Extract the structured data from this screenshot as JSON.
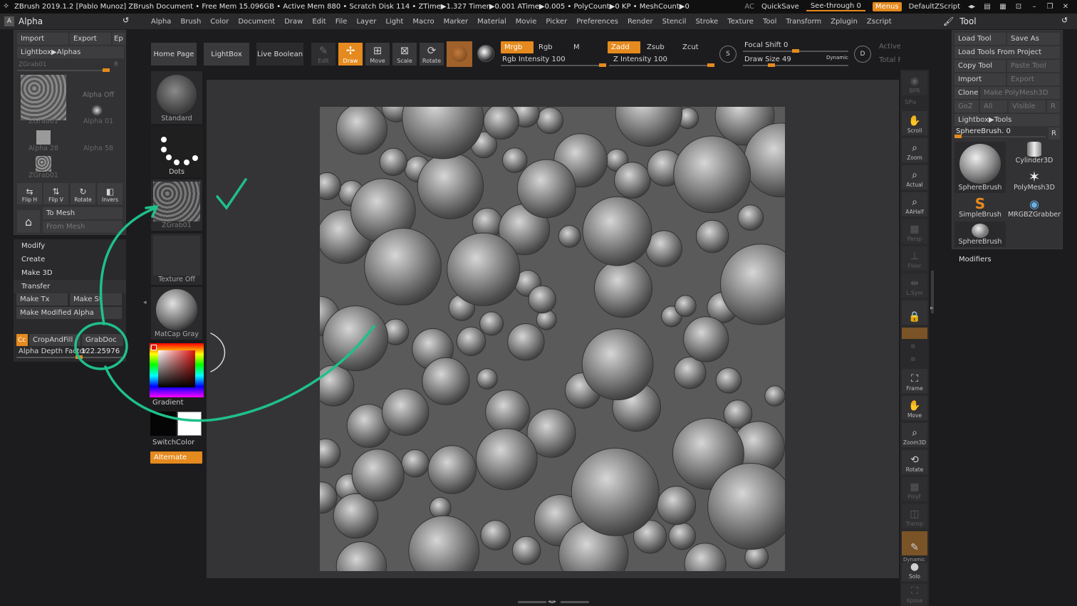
{
  "titlebar": {
    "text": "ZBrush 2019.1.2 [Pablo Munoz]   ZBrush Document   • Free Mem 15.096GB • Active Mem 880 • Scratch Disk 114 •  ZTime▶1.327 Timer▶0.001 ATime▶0.005 • PolyCount▶0 KP • MeshCount▶0",
    "ac": "AC",
    "quicksave": "QuickSave",
    "seethrough": "See-through  0",
    "menus": "Menus",
    "script": "DefaultZScript"
  },
  "menubar": {
    "palette_title": "Alpha",
    "items": [
      "Alpha",
      "Brush",
      "Color",
      "Document",
      "Draw",
      "Edit",
      "File",
      "Layer",
      "Light",
      "Macro",
      "Marker",
      "Material",
      "Movie",
      "Picker",
      "Preferences",
      "Render",
      "Stencil",
      "Stroke",
      "Texture",
      "Tool",
      "Transform",
      "Zplugin",
      "Zscript"
    ]
  },
  "alpha_panel": {
    "import": "Import",
    "export": "Export",
    "ep": "Ep",
    "lightbox": "Lightbox▶Alphas",
    "slider_label": "ZGrab01",
    "r": "R",
    "alpha_off": "Alpha Off",
    "zgrab1": "ZGrab01",
    "alpha01": "Alpha 01",
    "alpha28": "Alpha 28",
    "alpha58": "Alpha 58",
    "zgrab2": "ZGrab01",
    "fliph": "Flip H",
    "flipv": "Flip V",
    "rotate": "Rotate",
    "invers": "Invers",
    "tomesh": "To Mesh",
    "frommesh": "From Mesh"
  },
  "alpha_menu": {
    "modify": "Modify",
    "create": "Create",
    "make3d": "Make 3D",
    "transfer": "Transfer",
    "maketx": "Make Tx",
    "makest": "Make St",
    "makemodified": "Make Modified Alpha",
    "cc": "Cc",
    "cropandfill": "CropAndFill",
    "grabdoc": "GrabDoc",
    "depth_label": "Alpha Depth Factor",
    "depth_value": "122.25976",
    "depth_level": 0.6
  },
  "shelf": {
    "homepage": "Home Page",
    "lightbox": "LightBox",
    "liveboolean": "Live Boolean",
    "edit": "Edit",
    "draw": "Draw",
    "move": "Move",
    "scale": "Scale",
    "rotate": "Rotate",
    "mrgb": "Mrgb",
    "rgb": "Rgb",
    "m": "M",
    "rgb_intensity": "Rgb Intensity 100",
    "zadd": "Zadd",
    "zsub": "Zsub",
    "zcut": "Zcut",
    "z_intensity": "Z Intensity 100",
    "focal_shift": "Focal Shift 0",
    "draw_size": "Draw Size 49",
    "dynamic": "Dynamic",
    "active_points": "Active Points Co",
    "total_points": "Total Points Co",
    "draw_size_level": 0.25,
    "focal_shift_level": 0.5
  },
  "material_column": {
    "standard": "Standard",
    "dots": "Dots",
    "zgrab": "ZGrab01",
    "texture_off": "Texture Off",
    "matcap": "MatCap Gray",
    "gradient": "Gradient",
    "switchcolor": "SwitchColor",
    "alternate": "Alternate"
  },
  "right_bar": {
    "bpr": "BPR",
    "spix": "SPix",
    "scroll": "Scroll",
    "zoom": "Zoom",
    "actual": "Actual",
    "aahalf": "AAHalf",
    "persp": "Persp",
    "floor": "Floor",
    "lsym": "L.Sym",
    "frame": "Frame",
    "move": "Move",
    "zoom3d": "Zoom3D",
    "rotate": "Rotate",
    "polyf": "PolyF",
    "transp": "Transp",
    "dynamic": "Dynamic",
    "solo": "Solo",
    "xpose": "Xpose"
  },
  "tool_panel": {
    "title": "Tool",
    "load_tool": "Load Tool",
    "save_as": "Save As",
    "load_from_project": "Load Tools From Project",
    "copy_tool": "Copy Tool",
    "paste_tool": "Paste Tool",
    "import": "Import",
    "export": "Export",
    "clone": "Clone",
    "make_polymesh": "Make PolyMesh3D",
    "goz": "GoZ",
    "all": "All",
    "visible": "Visible",
    "r": "R",
    "lightbox": "Lightbox▶Tools",
    "spherebrush_slider": "SphereBrush. 0",
    "spherebrush": "SphereBrush",
    "cylinder": "Cylinder3D",
    "polymesh": "PolyMesh3D",
    "simplebrush": "SimpleBrush",
    "mrgbz": "MRGBZGrabber",
    "spherebrush2": "SphereBrush",
    "modifiers": "Modifiers"
  },
  "colors": {
    "accent": "#e58a1e",
    "annotation": "#1fc08a"
  }
}
